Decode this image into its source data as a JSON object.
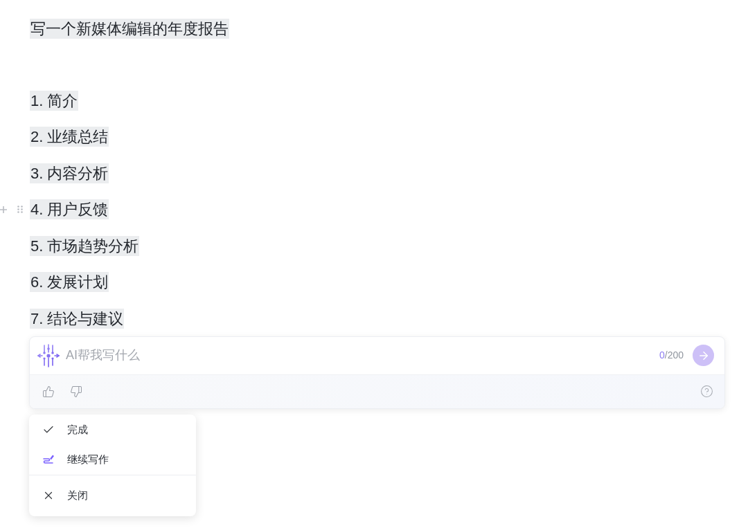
{
  "document": {
    "title": {
      "text": "写一个新媒体编辑的年度报告",
      "highlighted": true
    },
    "lines": [
      {
        "text": "1. 简介",
        "highlighted": true,
        "hovered": false
      },
      {
        "text": "2. 业绩总结",
        "highlighted": true,
        "hovered": false
      },
      {
        "text": "3. 内容分析",
        "highlighted": true,
        "hovered": false
      },
      {
        "text": "4. 用户反馈",
        "highlighted": true,
        "hovered": true
      },
      {
        "text": "5. 市场趋势分析",
        "highlighted": true,
        "hovered": false
      },
      {
        "text": "6. 发展计划",
        "highlighted": true,
        "hovered": false
      },
      {
        "text": "7. 结论与建议",
        "highlighted": true,
        "hovered": false
      }
    ]
  },
  "ai_panel": {
    "input": {
      "placeholder": "AI帮我写什么"
    },
    "counter": {
      "current": "0",
      "rest": "/200"
    },
    "send_button": {
      "disabled": true
    }
  },
  "menu": {
    "groups": [
      [
        {
          "kind": "done",
          "label": "完成"
        },
        {
          "kind": "continue",
          "label": "继续写作"
        }
      ],
      [
        {
          "kind": "close",
          "label": "关闭"
        }
      ]
    ]
  }
}
